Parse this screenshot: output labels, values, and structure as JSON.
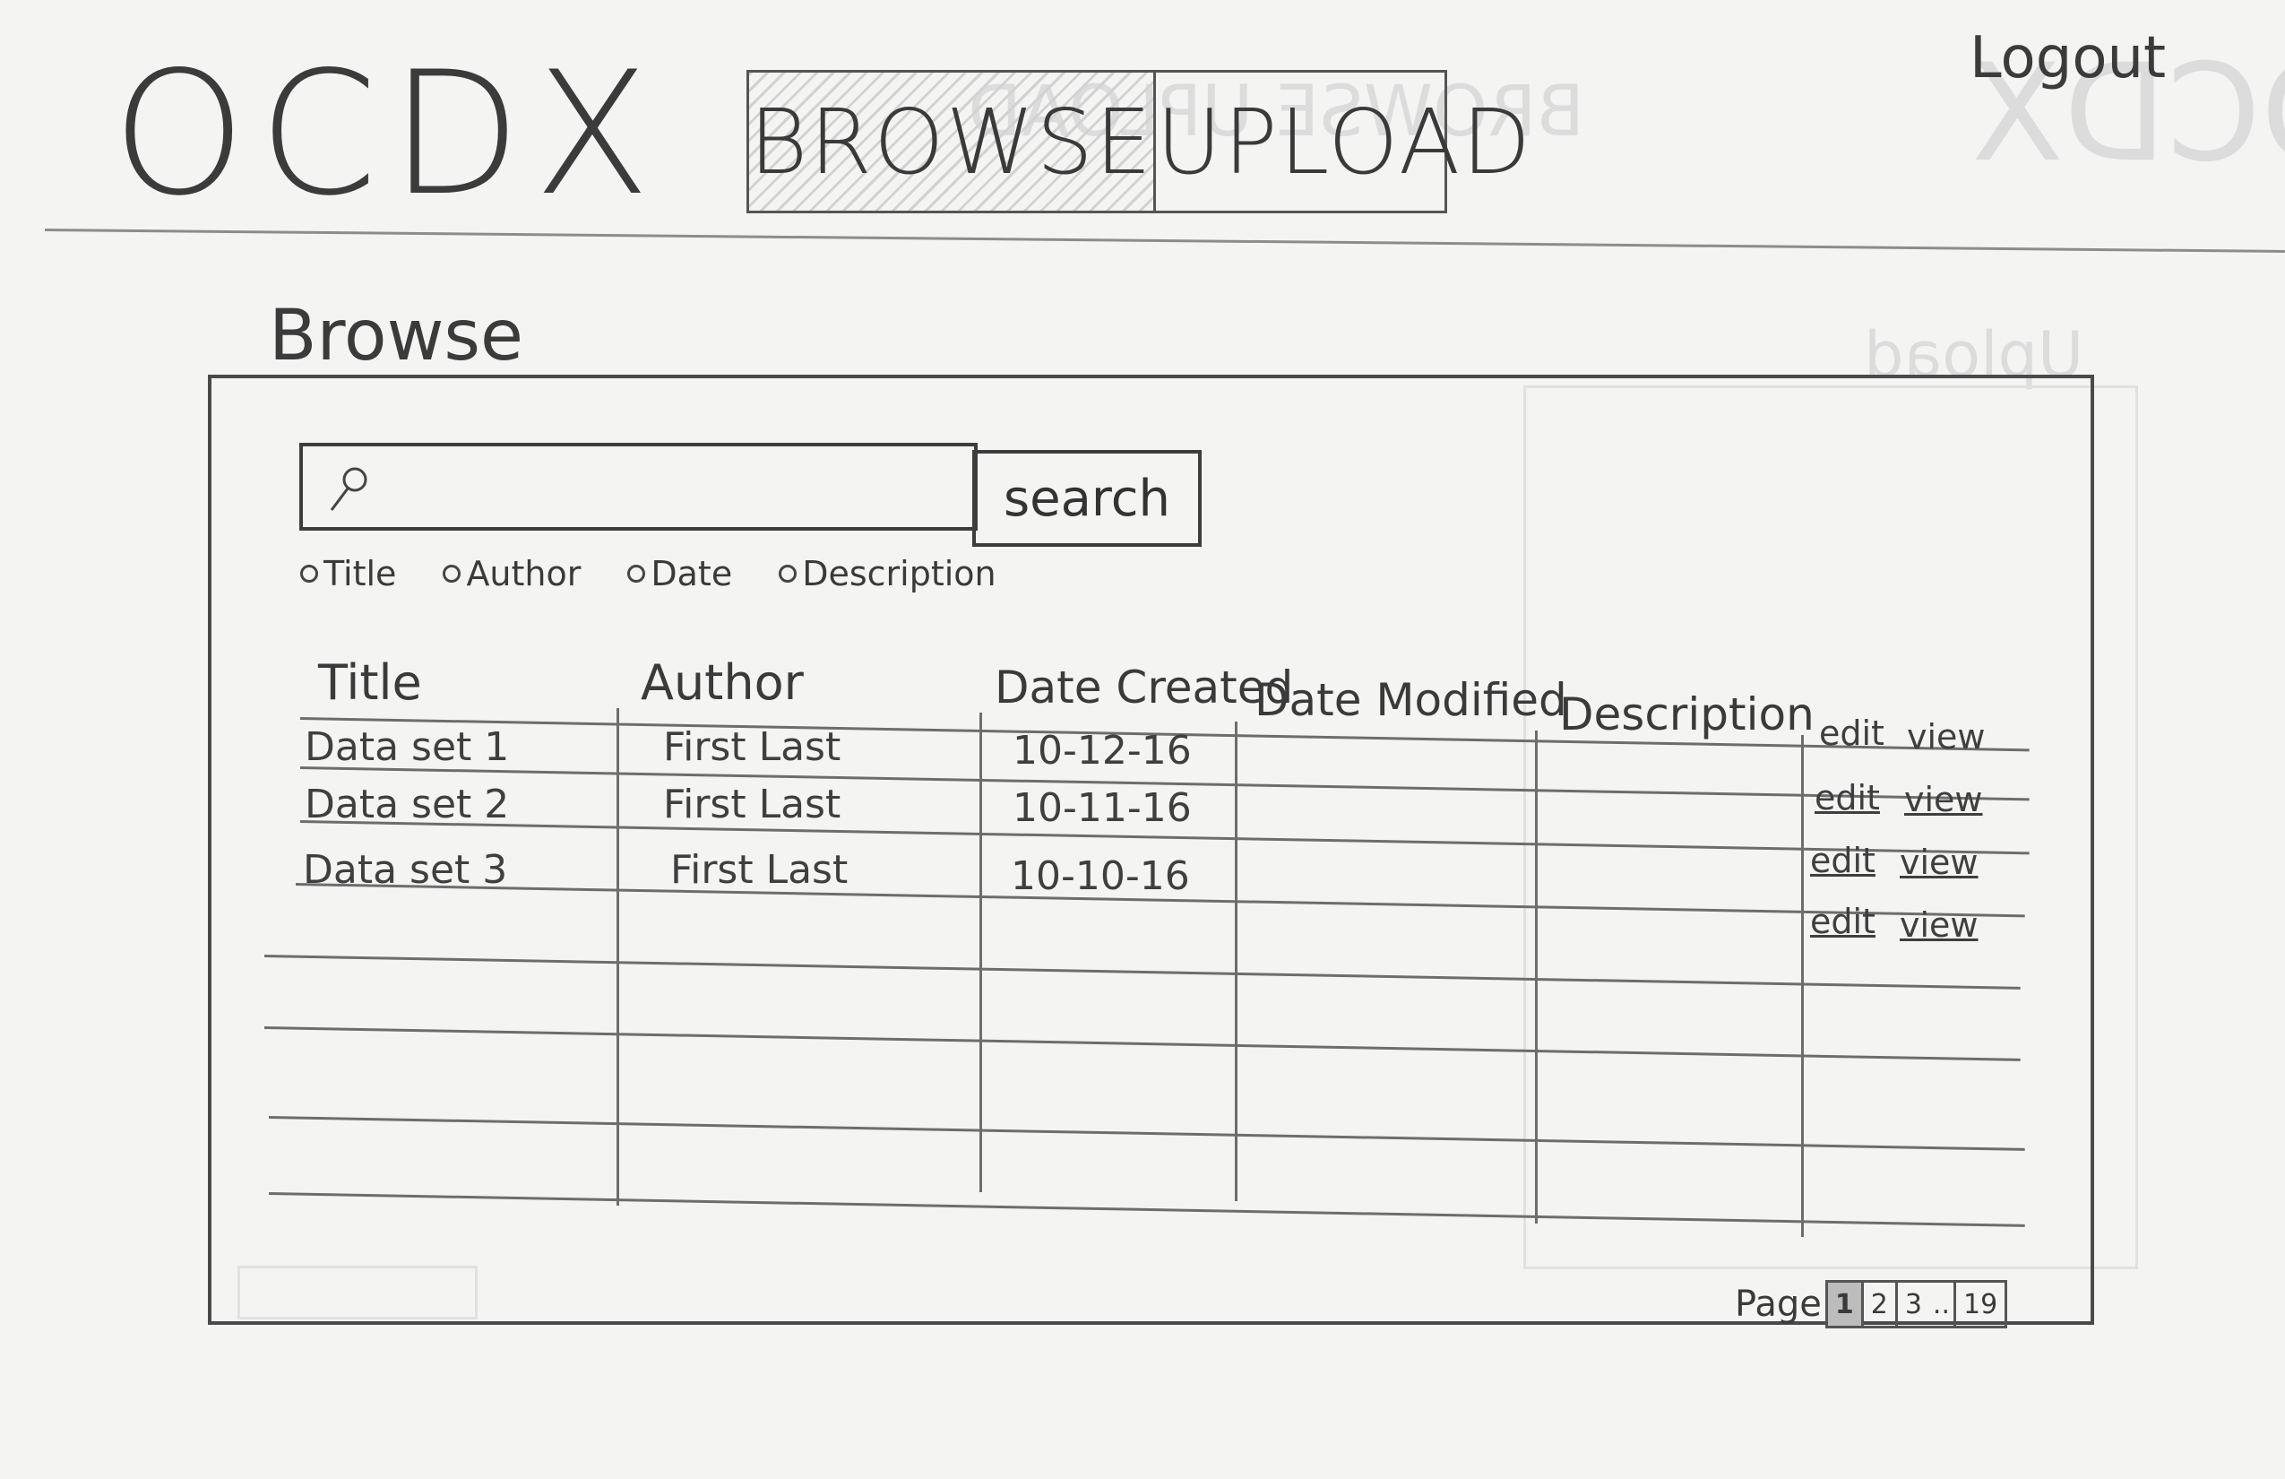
{
  "app": {
    "logo": "OCDX",
    "logout_label": "Logout"
  },
  "nav": {
    "tabs": [
      {
        "label": "BROWSE",
        "active": true
      },
      {
        "label": "UPLOAD",
        "active": false
      }
    ]
  },
  "page": {
    "title": "Browse"
  },
  "search": {
    "button_label": "search",
    "placeholder": ""
  },
  "filters": [
    "Title",
    "Author",
    "Date",
    "Description"
  ],
  "table": {
    "columns": [
      "Title",
      "Author",
      "Date Created",
      "Date Modified",
      "Description"
    ],
    "rows": [
      {
        "title": "Data set 1",
        "author": "First Last",
        "date_created": "10-12-16",
        "date_modified": "",
        "description": ""
      },
      {
        "title": "Data set 2",
        "author": "First Last",
        "date_created": "10-11-16",
        "date_modified": "",
        "description": ""
      },
      {
        "title": "Data set 3",
        "author": "First Last",
        "date_created": "10-10-16",
        "date_modified": "",
        "description": ""
      }
    ],
    "actions": {
      "edit": "edit",
      "view": "view"
    }
  },
  "pagination": {
    "label": "Page",
    "pages": [
      "1",
      "2",
      "3"
    ],
    "ellipsis": "..",
    "last_page": "19",
    "current": "1"
  }
}
